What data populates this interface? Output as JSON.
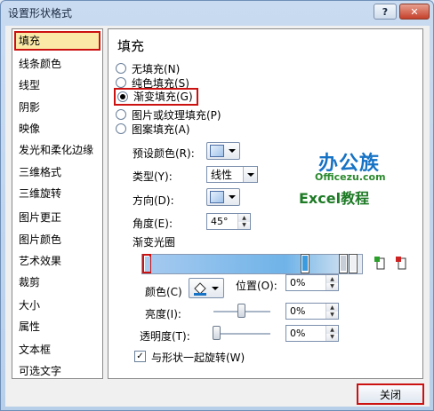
{
  "window": {
    "title": "设置形状格式",
    "help_label": "?",
    "close_glyph": "✕"
  },
  "sidebar": {
    "items": [
      {
        "label": "填充"
      },
      {
        "label": "线条颜色"
      },
      {
        "label": "线型"
      },
      {
        "label": "阴影"
      },
      {
        "label": "映像"
      },
      {
        "label": "发光和柔化边缘"
      },
      {
        "label": "三维格式"
      },
      {
        "label": "三维旋转"
      },
      {
        "label": "图片更正"
      },
      {
        "label": "图片颜色"
      },
      {
        "label": "艺术效果"
      },
      {
        "label": "裁剪"
      },
      {
        "label": "大小"
      },
      {
        "label": "属性"
      },
      {
        "label": "文本框"
      },
      {
        "label": "可选文字"
      }
    ]
  },
  "panel": {
    "heading": "填充",
    "fill_options": [
      {
        "label": "无填充(N)",
        "checked": false
      },
      {
        "label": "纯色填充(S)",
        "checked": false
      },
      {
        "label": "渐变填充(G)",
        "checked": true
      },
      {
        "label": "图片或纹理填充(P)",
        "checked": false
      },
      {
        "label": "图案填充(A)",
        "checked": false
      }
    ],
    "preset_label": "预设颜色(R):",
    "type_label": "类型(Y):",
    "type_value": "线性",
    "direction_label": "方向(D):",
    "angle_label": "角度(E):",
    "angle_value": "45°",
    "stops_label": "渐变光圈",
    "color_label": "颜色(C)",
    "position_label": "位置(O):",
    "position_value": "0%",
    "brightness_label": "亮度(I):",
    "brightness_value": "0%",
    "transparency_label": "透明度(T):",
    "transparency_value": "0%",
    "rotate_label": "与形状一起旋转(W)",
    "rotate_checked": true
  },
  "watermark": {
    "line1": "办公族",
    "line2": "Officezu.com",
    "line3": "Excel教程"
  },
  "footer": {
    "close_label": "关闭"
  },
  "colors": {
    "accent_red": "#cc1111",
    "selection": "#fbe9a8",
    "watermark_blue": "#1672c4",
    "watermark_green": "#1d7a25"
  }
}
